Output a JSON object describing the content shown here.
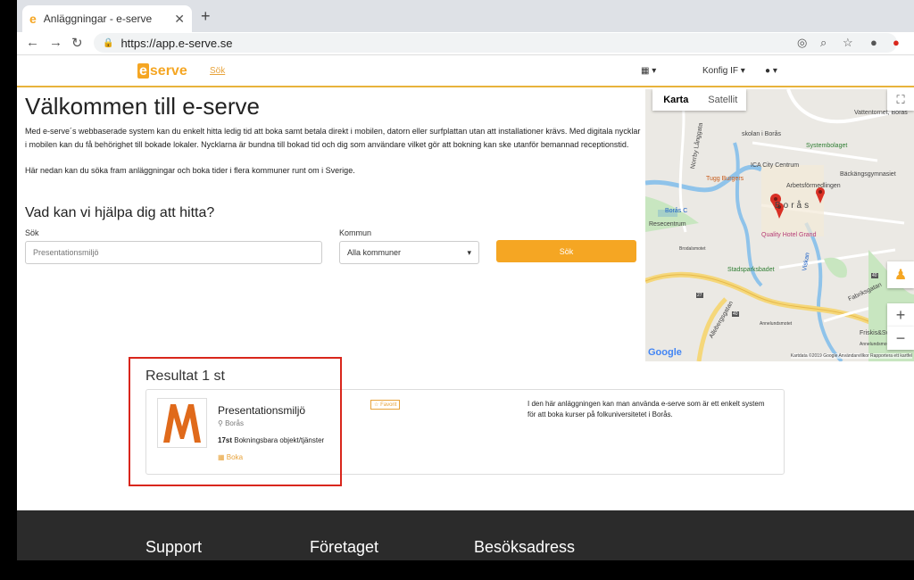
{
  "browser": {
    "tab_title": "Anläggningar - e-serve",
    "tab_favicon": "e",
    "url": "https://app.e-serve.se"
  },
  "header": {
    "logo_prefix": "e",
    "logo_text": "serve",
    "search_link": "Sök",
    "calendar_caret": "▾",
    "config_label": "Konfig IF ▾",
    "globe_caret": "▾"
  },
  "hero": {
    "title": "Välkommen till e-serve",
    "intro1": "Med e-serve´s webbaserade system kan du enkelt hitta ledig tid att boka samt betala direkt i mobilen, datorn eller surfplattan utan att installationer krävs. Med digitala nycklar i mobilen kan du få behörighet till bokade lokaler. Nycklarna är bundna till bokad tid och dig som användare vilket gör att bokning kan ske utanför bemannad receptionstid.",
    "intro2": "Här nedan kan du söka fram anläggningar och boka tider i flera kommuner runt om i Sverige.",
    "help_question": "Vad kan vi hjälpa dig att hitta?",
    "search_label": "Sök",
    "search_placeholder": "Presentationsmiljö",
    "kommun_label": "Kommun",
    "kommun_value": "Alla kommuner",
    "search_button": "Sök"
  },
  "map": {
    "tab_map": "Karta",
    "tab_satellite": "Satellit",
    "labels": {
      "skolan": "skolan i Borås",
      "vattentornet": "Vattentornet, Borås",
      "systembolaget": "Systembolaget",
      "ica": "ICA City Centrum",
      "backang": "Bäckängsgymnasiet",
      "tugg": "Tugg Burgers",
      "arbets": "Arbetsförmedlingen",
      "boras": "Borås",
      "boras_c": "Borås C",
      "resecentrum": "Resecentrum",
      "quality": "Quality Hotel Grand",
      "norrby": "Norrby Långgata",
      "brodals": "Brodalsmotet",
      "stadsparks": "Stadsparksbadet",
      "fabriks": "Fabriksgatan",
      "viskan": "Viskan",
      "annelund": "Annelundsmotet",
      "annelund2": "Annelundsmotet",
      "friskis": "Friskis&Svettis B",
      "alleberg": "Allebergsgatan",
      "r40": "40",
      "r40b": "40",
      "r27": "27"
    },
    "google": "Google",
    "attribution": "Kartdata ©2019 Google    Användarvillkor    Rapportera ett kartfel"
  },
  "results": {
    "count": "Resultat 1 st",
    "items": [
      {
        "logo_letter": "M",
        "name": "Presentationsmiljö",
        "location": "Borås",
        "count_number": "17st",
        "count_text": "Bokningsbara objekt/tjänster",
        "book": "Boka",
        "favorite": "Favorit",
        "description": "I den här anläggningen kan man använda e-serve som är ett enkelt system för att boka kurser på folkuniversitetet i Borås."
      }
    ]
  },
  "footer": {
    "support": "Support",
    "company": "Företaget",
    "address": "Besöksadress"
  },
  "colors": {
    "brand": "#f5a623",
    "highlight": "#d9261c",
    "logo_m": "#e06a1b"
  }
}
